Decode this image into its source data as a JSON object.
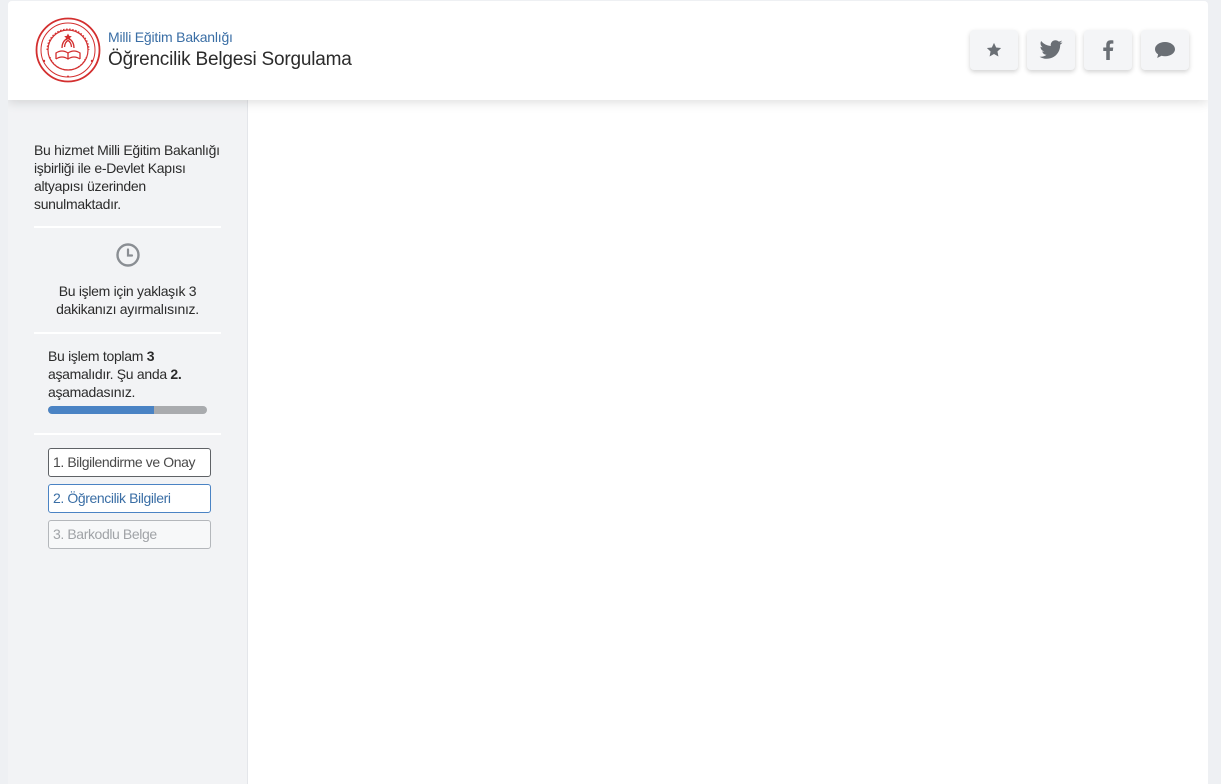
{
  "header": {
    "ministry": "Milli Eğitim Bakanlığı",
    "title": "Öğrencilik Belgesi Sorgulama",
    "buttons": [
      {
        "icon": "star-icon"
      },
      {
        "icon": "twitter-icon"
      },
      {
        "icon": "facebook-icon"
      },
      {
        "icon": "comment-icon"
      }
    ]
  },
  "sidebar": {
    "info": "Bu hizmet Milli Eğitim Bakanlığı işbirliği ile e-Devlet Kapısı altyapısı üzerinden sunulmaktadır.",
    "duration": "Bu işlem için yaklaşık 3 dakikanızı ayırmalısınız.",
    "stages": {
      "prefix": "Bu işlem toplam ",
      "total": "3",
      "middle": " aşamalıdır. Şu anda ",
      "current": "2.",
      "suffix": " aşamadasınız.",
      "progress_fraction": 0.667
    },
    "steps": [
      {
        "label": "1. Bilgilendirme ve Onay",
        "state": "done"
      },
      {
        "label": "2. Öğrencilik Bilgileri",
        "state": "active"
      },
      {
        "label": "3. Barkodlu Belge",
        "state": "pending"
      }
    ]
  },
  "colors": {
    "accent": "#4a83c4",
    "ministry_text": "#3a6ea5",
    "logo_red": "#d32f2f",
    "sidebar_bg": "#f2f3f5"
  }
}
